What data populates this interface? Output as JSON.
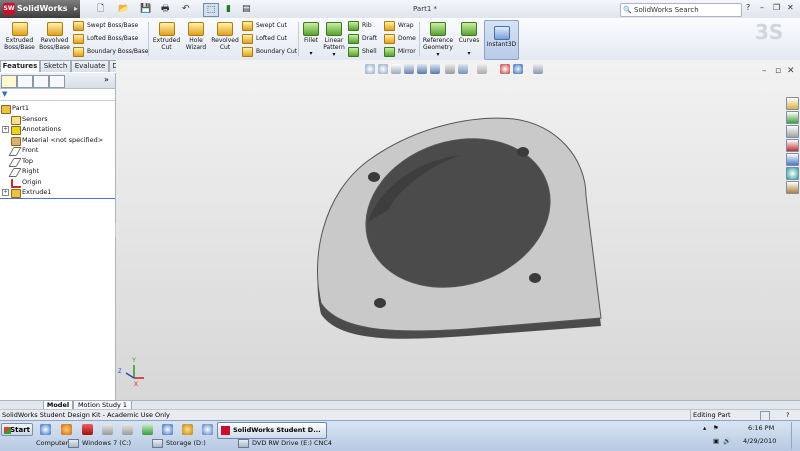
{
  "app": {
    "name": "SolidWorks",
    "logo_abbrev": "SW",
    "document_title": "Part1 *",
    "search_placeholder": "SolidWorks Search",
    "help_glyph": "?",
    "window_controls": [
      "–",
      "❐",
      "✕"
    ]
  },
  "ribbon": {
    "big_buttons": [
      {
        "name": "extruded-boss-base",
        "line1": "Extruded",
        "line2": "Boss/Base"
      },
      {
        "name": "revolved-boss-base",
        "line1": "Revolved",
        "line2": "Boss/Base"
      },
      {
        "name": "extruded-cut",
        "line1": "Extruded",
        "line2": "Cut"
      },
      {
        "name": "hole-wizard",
        "line1": "Hole",
        "line2": "Wizard"
      },
      {
        "name": "revolved-cut",
        "line1": "Revolved",
        "line2": "Cut"
      },
      {
        "name": "fillet",
        "line1": "Fillet",
        "line2": ""
      },
      {
        "name": "linear-pattern",
        "line1": "Linear",
        "line2": "Pattern"
      },
      {
        "name": "reference-geometry",
        "line1": "Reference",
        "line2": "Geometry"
      },
      {
        "name": "curves",
        "line1": "Curves",
        "line2": ""
      },
      {
        "name": "instant3d",
        "line1": "Instant3D",
        "line2": ""
      }
    ],
    "boss_small": [
      "Swept Boss/Base",
      "Lofted Boss/Base",
      "Boundary Boss/Base"
    ],
    "cut_small": [
      "Swept Cut",
      "Lofted Cut",
      "Boundary Cut"
    ],
    "feature_small": [
      "Rib",
      "Draft",
      "Shell"
    ],
    "extra_small": [
      "Wrap",
      "Dome",
      "Mirror"
    ],
    "dropdown_glyph": "▾"
  },
  "command_tabs": [
    "Features",
    "Sketch",
    "Evaluate",
    "DimXpert"
  ],
  "feature_tree": {
    "filter_glyph": "▼",
    "expand_glyph": "+",
    "items": [
      {
        "label": "Part1"
      },
      {
        "label": "Sensors"
      },
      {
        "label": "Annotations"
      },
      {
        "label": "Material <not specified>"
      },
      {
        "label": "Front"
      },
      {
        "label": "Top"
      },
      {
        "label": "Right"
      },
      {
        "label": "Origin"
      },
      {
        "label": "Extrude1"
      }
    ]
  },
  "viewport": {
    "triad": {
      "x": "X",
      "y": "Y",
      "z": "Z"
    }
  },
  "bottom_tabs": [
    "Model",
    "Motion Study 1"
  ],
  "status": {
    "left": "SolidWorks Student Design Kit - Academic Use Only",
    "mode": "Editing Part",
    "help": "?"
  },
  "taskbar": {
    "start": "Start",
    "active_task": "SolidWorks Student D...",
    "drives": [
      "Computer",
      "Windows 7 (C:)",
      "Storage (D:)",
      "DVD RW Drive (E:) CNC4"
    ],
    "time": "6:16 PM",
    "date": "4/29/2010"
  },
  "colors": {
    "accent": "#4a78c8",
    "part_face": "#c8c8c8",
    "part_edge": "#4a4a4a",
    "viewport_top": "#f2f2f2",
    "viewport_bottom": "#d7d7d7"
  }
}
